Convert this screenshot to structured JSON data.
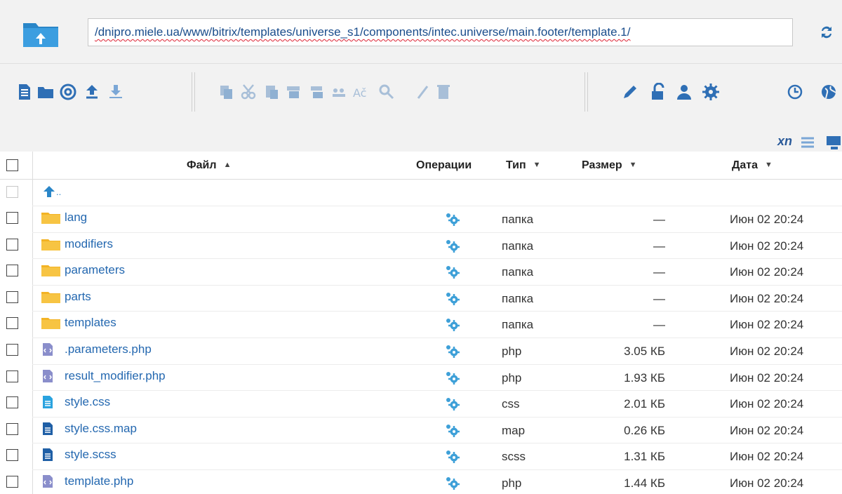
{
  "path": {
    "value": "/dnipro.miele.ua/www/bitrix/templates/universe_s1/components/intec.universe/main.footer/template.1/"
  },
  "toolbar": {
    "icons": [
      "new-file-icon",
      "open-folder-icon",
      "email-icon",
      "upload-icon",
      "download-icon",
      "copy-icon",
      "cut-icon",
      "paste-icon",
      "pack-icon",
      "unpack-icon",
      "group-icon",
      "rename-icon",
      "search-icon",
      "edit-icon",
      "delete-icon",
      "pencil-icon",
      "unlock-icon",
      "user-icon",
      "settings-icon",
      "history-icon",
      "globe-icon"
    ],
    "xn_label": "xn"
  },
  "columns": {
    "file": "Файл",
    "operations": "Операции",
    "type": "Тип",
    "size": "Размер",
    "date": "Дата"
  },
  "up_label": "..",
  "rows": [
    {
      "name": "lang",
      "kind": "folder",
      "type": "папка",
      "size": "—",
      "date": "Июн  02 20:24"
    },
    {
      "name": "modifiers",
      "kind": "folder",
      "type": "папка",
      "size": "—",
      "date": "Июн  02 20:24"
    },
    {
      "name": "parameters",
      "kind": "folder",
      "type": "папка",
      "size": "—",
      "date": "Июн  02 20:24"
    },
    {
      "name": "parts",
      "kind": "folder",
      "type": "папка",
      "size": "—",
      "date": "Июн  02 20:24"
    },
    {
      "name": "templates",
      "kind": "folder",
      "type": "папка",
      "size": "—",
      "date": "Июн  02 20:24"
    },
    {
      "name": ".parameters.php",
      "kind": "php",
      "type": "php",
      "size": "3.05 КБ",
      "date": "Июн  02 20:24"
    },
    {
      "name": "result_modifier.php",
      "kind": "php",
      "type": "php",
      "size": "1.93 КБ",
      "date": "Июн 02 20:24"
    },
    {
      "name": "style.css",
      "kind": "css",
      "type": "css",
      "size": "2.01 КБ",
      "date": "Июн 02 20:24"
    },
    {
      "name": "style.css.map",
      "kind": "map",
      "type": "map",
      "size": "0.26 КБ",
      "date": "Июн 02 20:24"
    },
    {
      "name": "style.scss",
      "kind": "scss",
      "type": "scss",
      "size": "1.31 КБ",
      "date": "Июн 02 20:24"
    },
    {
      "name": "template.php",
      "kind": "php",
      "type": "php",
      "size": "1.44 КБ",
      "date": "Июн  02 20:24"
    }
  ],
  "colors": {
    "accent": "#2468b0",
    "folder": "#f3b325",
    "toolbar_bg": "#f2f2f2",
    "ops": "#3ea0d8"
  }
}
